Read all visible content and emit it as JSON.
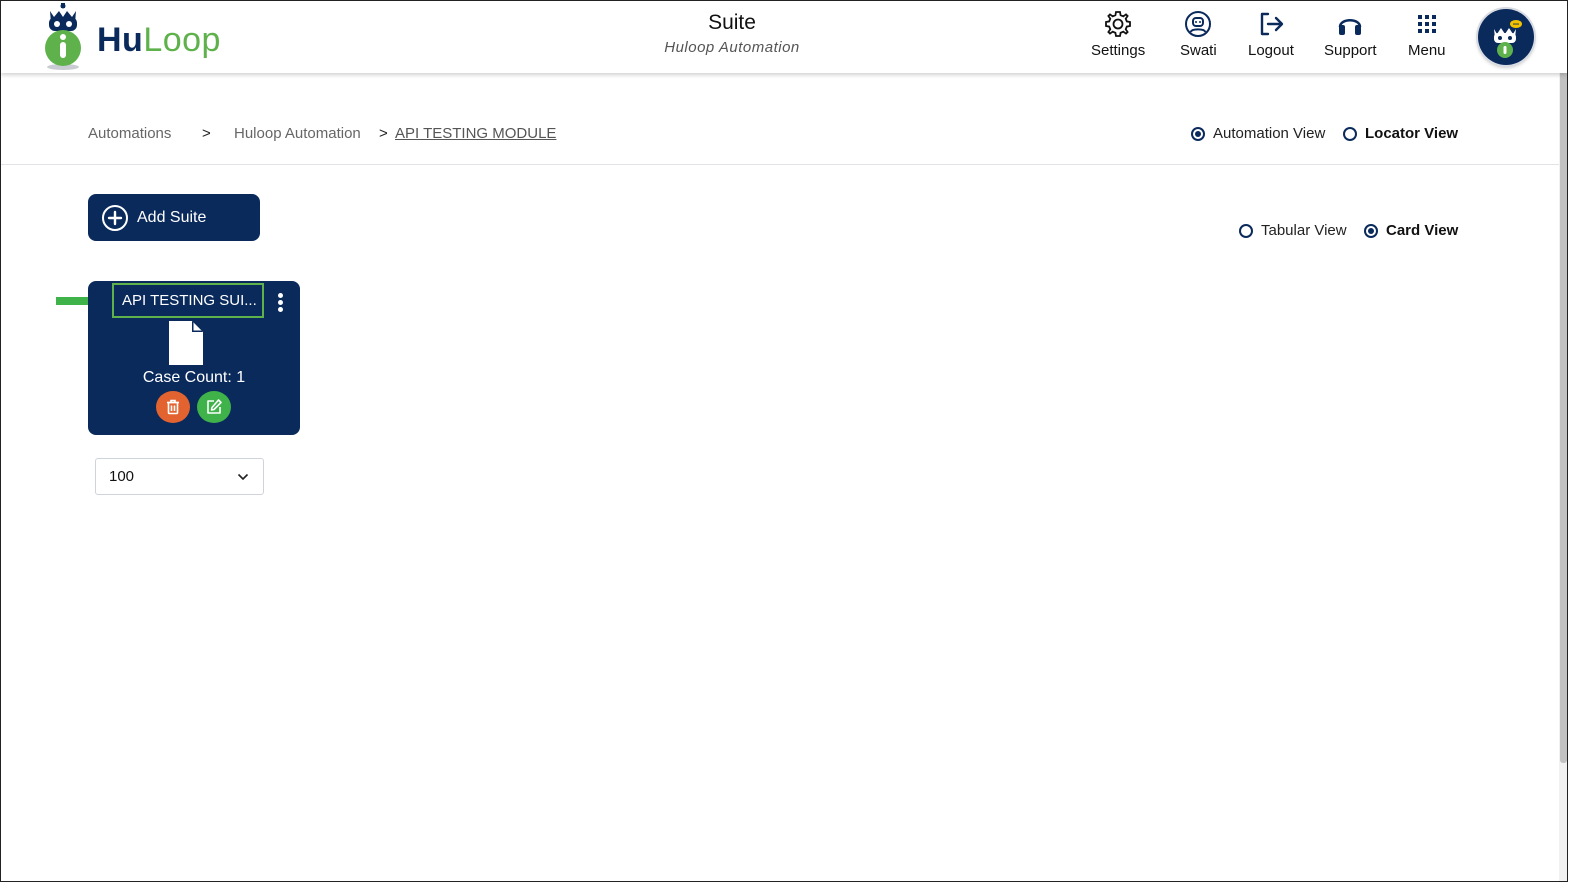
{
  "header": {
    "brand": {
      "hu": "Hu",
      "loop": "Loop"
    },
    "title": "Suite",
    "subtitle": "Huloop Automation",
    "nav": [
      {
        "label": "Settings",
        "icon": "gear-icon"
      },
      {
        "label": "Swati",
        "icon": "user-circle-icon"
      },
      {
        "label": "Logout",
        "icon": "logout-icon"
      },
      {
        "label": "Support",
        "icon": "headphones-icon"
      },
      {
        "label": "Menu",
        "icon": "grid-menu-icon"
      }
    ]
  },
  "breadcrumb": {
    "items": [
      "Automations",
      "Huloop Automation",
      "API TESTING MODULE"
    ],
    "separator": ">"
  },
  "view_mode": {
    "options": [
      "Automation View",
      "Locator View"
    ],
    "selected": "Automation View"
  },
  "layout_mode": {
    "options": [
      "Tabular View",
      "Card View"
    ],
    "selected": "Card View"
  },
  "toolbar": {
    "add_suite_label": "Add Suite"
  },
  "cards": [
    {
      "title": "API TESTING SUI...",
      "case_count_text": "Case Count: 1"
    }
  ],
  "pagination": {
    "page_size": "100"
  },
  "colors": {
    "primary": "#0a2a5c",
    "accent_green": "#5fb24b",
    "delete": "#e2632f",
    "edit": "#3fb24a"
  }
}
